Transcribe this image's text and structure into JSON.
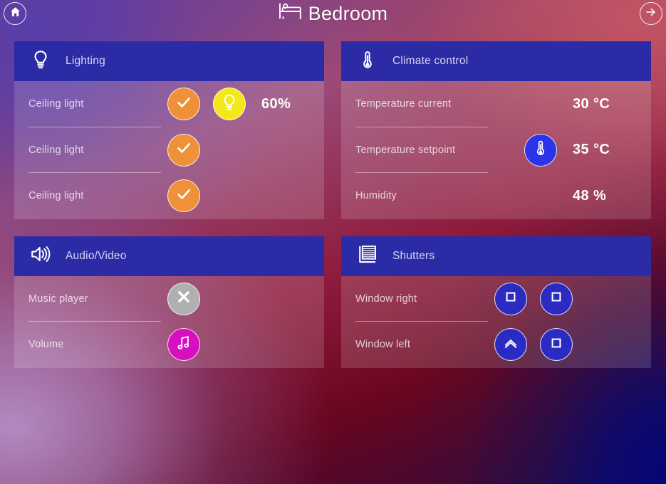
{
  "header": {
    "title": "Bedroom",
    "title_icon": "bed-icon",
    "home_button": "home-icon",
    "next_button": "arrow-right-icon"
  },
  "theme": {
    "card_header_bg": "#2b2ba6",
    "orange": "#ef9139",
    "yellow": "#f2e81c",
    "blue": "#2b34e8",
    "gray": "#b0b0b0",
    "magenta": "#d60fc0",
    "navy": "#2b2bc4"
  },
  "cards": [
    {
      "id": "lighting",
      "title": "Lighting",
      "icon": "lightbulb-icon",
      "rows": [
        {
          "label": "Ceiling light",
          "controls": [
            {
              "icon": "check-icon",
              "color": "orange"
            },
            {
              "icon": "lightbulb-icon",
              "color": "yellow"
            }
          ],
          "value": "60%"
        },
        {
          "label": "Ceiling light",
          "controls": [
            {
              "icon": "check-icon",
              "color": "orange"
            }
          ],
          "value": ""
        },
        {
          "label": "Ceiling light",
          "controls": [
            {
              "icon": "check-icon",
              "color": "orange"
            }
          ],
          "value": ""
        }
      ]
    },
    {
      "id": "climate-control",
      "title": "Climate control",
      "icon": "thermometer-icon",
      "rows": [
        {
          "label": "Temperature current",
          "controls": [],
          "value": "30 °C"
        },
        {
          "label": "Temperature setpoint",
          "controls": [
            {
              "icon": "thermometer-icon",
              "color": "blue"
            }
          ],
          "value": "35 °C"
        },
        {
          "label": "Humidity",
          "controls": [],
          "value": "48 %"
        }
      ]
    },
    {
      "id": "audio-video",
      "title": "Audio/Video",
      "icon": "speaker-icon",
      "rows": [
        {
          "label": "Music player",
          "controls": [
            {
              "icon": "close-icon",
              "color": "gray"
            }
          ],
          "value": ""
        },
        {
          "label": "Volume",
          "controls": [
            {
              "icon": "music-note-icon",
              "color": "magenta"
            }
          ],
          "value": ""
        }
      ]
    },
    {
      "id": "shutters",
      "title": "Shutters",
      "icon": "blinds-icon",
      "rows": [
        {
          "label": "Window right",
          "controls": [
            {
              "icon": "stop-square-icon",
              "color": "navy"
            },
            {
              "icon": "stop-square-icon",
              "color": "navy"
            }
          ],
          "value": ""
        },
        {
          "label": "Window left",
          "controls": [
            {
              "icon": "chevron-up-icon",
              "color": "navy"
            },
            {
              "icon": "stop-square-icon",
              "color": "navy"
            }
          ],
          "value": ""
        }
      ]
    }
  ]
}
